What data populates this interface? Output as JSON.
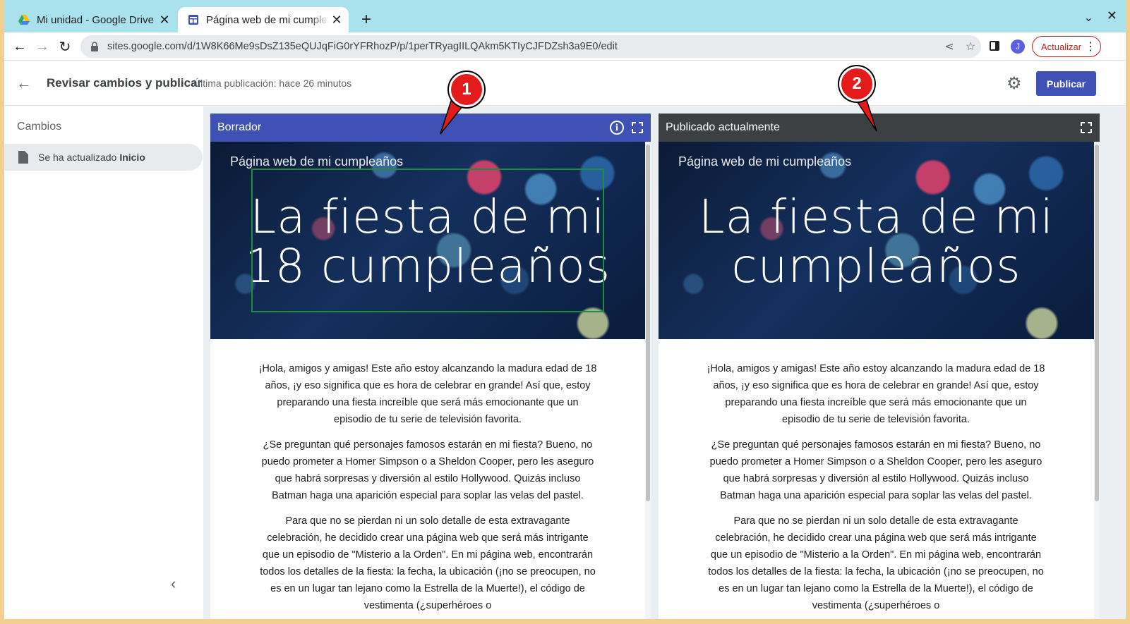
{
  "browser": {
    "tabs": [
      {
        "title": "Mi unidad - Google Drive",
        "favicon": "google-drive-icon",
        "active": false
      },
      {
        "title": "Página web de mi cumpleaños",
        "favicon": "google-sites-icon",
        "active": true
      }
    ],
    "new_tab_label": "+",
    "url": "sites.google.com/d/1W8K66Me9sDsZ135eQUJqFiG0rYFRhozP/p/1perTRyagIILQAkm5KTIyCJFDZsh3a9E0/edit",
    "profile_initial": "J",
    "update_label": "Actualizar"
  },
  "header": {
    "title": "Revisar cambios y publicar",
    "last_published": "Última publicación: hace 26 minutos",
    "publish_label": "Publicar"
  },
  "sidebar": {
    "title": "Cambios",
    "items": [
      {
        "prefix": "Se ha actualizado",
        "page": "Inicio"
      }
    ]
  },
  "panes": {
    "draft": {
      "label": "Borrador",
      "site_name": "Página web de mi cumpleaños",
      "hero_line1": "La fiesta de mi",
      "hero_line2": "18 cumpleaños"
    },
    "published": {
      "label": "Publicado actualmente",
      "site_name": "Página web de mi cumpleaños",
      "hero_line1": "La fiesta de mi",
      "hero_line2": "cumpleaños"
    }
  },
  "content": {
    "paragraphs": [
      "¡Hola, amigos y amigas! Este año estoy alcanzando la madura edad de 18 años, ¡y eso significa que es hora de celebrar en grande! Así que, estoy preparando una fiesta increíble que será más emocionante que un episodio de tu serie de televisión favorita.",
      "¿Se preguntan qué personajes famosos estarán en mi fiesta? Bueno, no puedo prometer a Homer Simpson o a Sheldon Cooper, pero les aseguro que habrá sorpresas y diversión al estilo Hollywood. Quizás incluso Batman haga una aparición especial para soplar las velas del pastel.",
      "Para que no se pierdan ni un solo detalle de esta extravagante celebración, he decidido crear una página web que será más intrigante que un episodio de \"Misterio a la Orden\". En mi página web, encontrarán todos los detalles de la fiesta: la fecha, la ubicación (¡no se preocupen, no es en un lugar tan lejano como la Estrella de la Muerte!), el código de vestimenta (¿superhéroes o"
    ]
  },
  "callouts": [
    "1",
    "2"
  ],
  "colors": {
    "accent": "#3f51b5",
    "published_bar": "#3c4043",
    "update_red": "#c5221f",
    "highlight_green": "#1e8e3e",
    "callout_red": "#e31b1b"
  }
}
